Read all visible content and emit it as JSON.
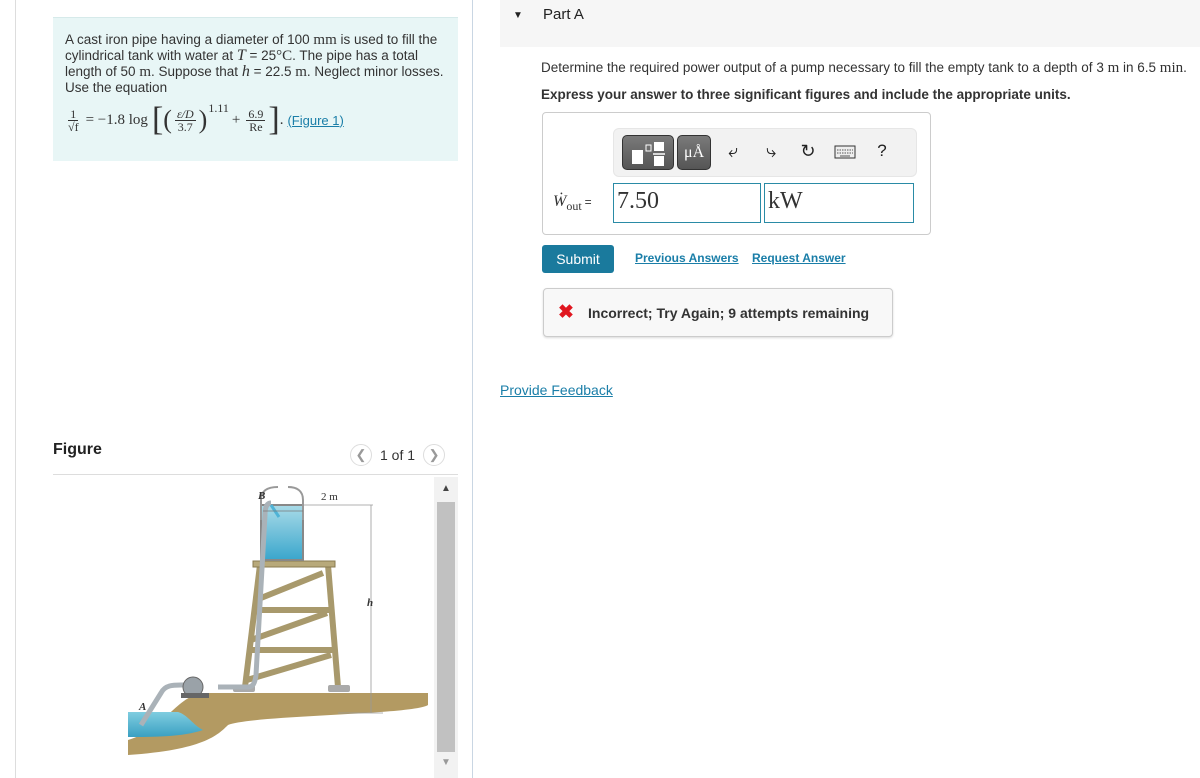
{
  "problem": {
    "text_1": "A cast iron pipe having a diameter of 100 ",
    "unit_mm": "mm",
    "text_2": " is used to fill the cylindrical tank with water at ",
    "var_T": "T",
    "text_3": " = 25",
    "unit_degC": "°C",
    "text_4": ". The pipe has a total length of 50 ",
    "unit_m": "m",
    "text_5": ". Suppose that ",
    "var_h": "h",
    "text_6": " = 22.5 ",
    "unit_m2": "m",
    "text_7": ". Neglect minor losses. Use the equation",
    "equation": {
      "lhs_num": "1",
      "lhs_den": "√f",
      "eq_coef": "= −1.8 log",
      "ratio_num": "ε/D",
      "ratio_den": "3.7",
      "exponent": "1.11",
      "plus": "+",
      "re_num": "6.9",
      "re_den": "Re",
      "period": "."
    },
    "figure_link": "(Figure 1)"
  },
  "figure": {
    "title": "Figure",
    "pager": "1 of 1",
    "labels": {
      "A": "A",
      "B": "B",
      "width": "2 m",
      "height": "h"
    }
  },
  "part": {
    "title": "Part A",
    "question_1": "Determine the required power output of a pump necessary to fill the empty tank to a depth of 3 ",
    "q_unit_m": "m",
    "question_2": " in 6.5 ",
    "q_unit_min": "min",
    "question_3": ".",
    "instruction": "Express your answer to three significant figures and include the appropriate units.",
    "toolbar": {
      "icons": [
        "templates-icon",
        "units-icon",
        "undo-icon",
        "redo-icon",
        "reset-icon",
        "keyboard-icon",
        "help-icon"
      ],
      "units_label": "μÅ",
      "help_label": "?"
    },
    "answer_label_var": "Ẇ",
    "answer_label_sub": "out",
    "answer_label_eq": "=",
    "value": "7.50",
    "unit": "kW",
    "submit_label": "Submit",
    "previous_answers": "Previous Answers",
    "request_answer": "Request Answer",
    "feedback": "Incorrect; Try Again; 9 attempts remaining",
    "provide_feedback": "Provide Feedback"
  },
  "colors": {
    "accent": "#1a7a9d",
    "link": "#1a7ea8",
    "error": "#e0161f",
    "problem_bg": "#e8f6f6"
  }
}
